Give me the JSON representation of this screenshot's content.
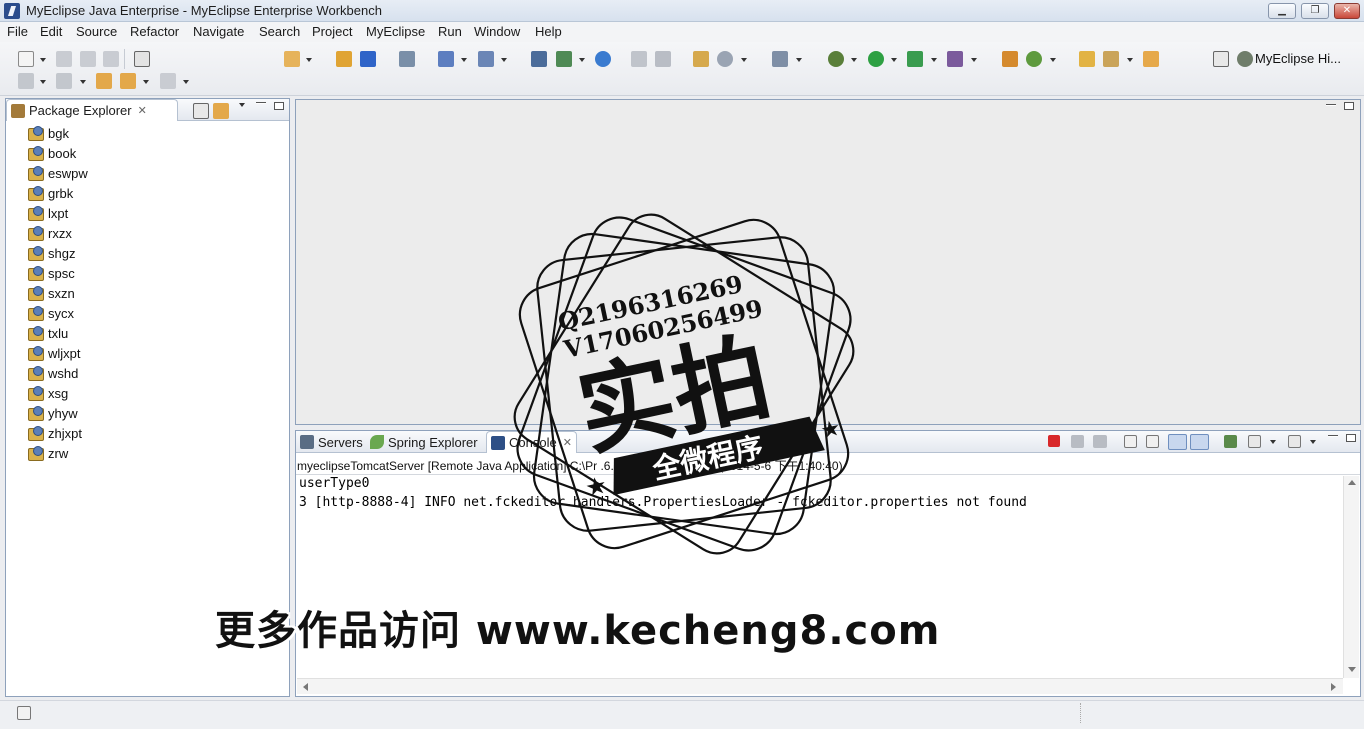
{
  "window": {
    "title": "MyEclipse Java Enterprise - MyEclipse Enterprise Workbench",
    "controls": {
      "minimize": "▁",
      "maximize": "❐",
      "close": "✕"
    }
  },
  "menu": [
    "File",
    "Edit",
    "Source",
    "Refactor",
    "Navigate",
    "Search",
    "Project",
    "MyEclipse",
    "Run",
    "Window",
    "Help"
  ],
  "toolbar": {
    "perspective_label": "MyEclipse Hi..."
  },
  "package_explorer": {
    "title": "Package Explorer",
    "projects": [
      "bgk",
      "book",
      "eswpw",
      "grbk",
      "lxpt",
      "rxzx",
      "shgz",
      "spsc",
      "sxzn",
      "sycx",
      "txlu",
      "wljxpt",
      "wshd",
      "xsg",
      "yhyw",
      "zhjxpt",
      "zrw"
    ]
  },
  "bottom_panel": {
    "tabs": [
      {
        "label": "Servers",
        "icon": "servers-icon"
      },
      {
        "label": "Spring Explorer",
        "icon": "spring-leaf-icon"
      },
      {
        "label": "Console",
        "icon": "console-icon"
      }
    ],
    "console_description": "myeclipseTomcatServer [Remote Java Application] C:\\Pr                                   .6.0_05\\bin\\javaw.exe (2014-5-6 下午1:40:40)",
    "console_lines": [
      "userType0",
      "3 [http-8888-4] INFO net.fckeditor.handlers.PropertiesLoader - fckeditor.properties not found"
    ]
  },
  "watermark": {
    "line1": "Q2196316269",
    "line2": "V17060256499",
    "big": "实拍",
    "ribbon": "全微程序"
  },
  "banner": "更多作品访问 www.kecheng8.com",
  "colors": {
    "accent": "#2b4c8c",
    "panel_border": "#8ea1bb",
    "terminate_red": "#d8282a"
  }
}
